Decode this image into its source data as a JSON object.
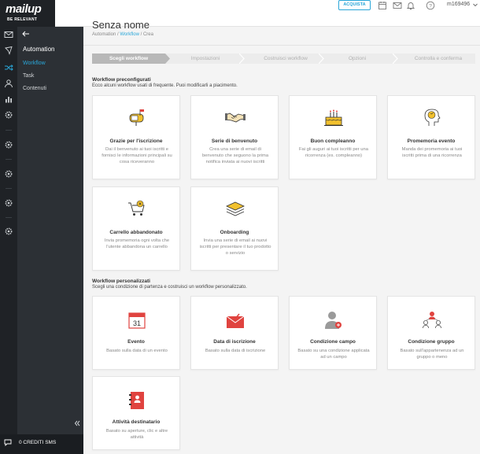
{
  "brand": {
    "name": "mailup",
    "tagline": "BE RELEVANT",
    "accent": "#2aa6d8"
  },
  "topbar": {
    "buy_label": "ACQUISTA",
    "username": "m169496"
  },
  "sidebar": {
    "title": "Automation",
    "items": [
      {
        "label": "Workflow",
        "active": true
      },
      {
        "label": "Task",
        "active": false
      },
      {
        "label": "Contenuti",
        "active": false
      }
    ],
    "credits": "0 CREDITI SMS"
  },
  "page": {
    "title": "Senza nome",
    "breadcrumb": [
      "Automation",
      "Workflow",
      "Crea"
    ]
  },
  "steps": [
    "Scegli workflow",
    "Impostazioni",
    "Costruisci workflow",
    "Opzioni",
    "Controlla e conferma"
  ],
  "preconfigured": {
    "title": "Workflow preconfigurati",
    "subtitle": "Ecco alcuni workflow usati di frequente. Puoi modificarli a piacimento.",
    "cards": [
      {
        "icon": "mailbox-icon",
        "title": "Grazie per l'iscrizione",
        "desc": "Dai il benvenuto ai tuoi iscritti e fornisci le informazioni principali su cosa riceveranno"
      },
      {
        "icon": "handshake-icon",
        "title": "Serie di benvenuto",
        "desc": "Crea una serie di email di benvenuto che seguono la prima notifica inviata ai nuovi iscritti"
      },
      {
        "icon": "cake-icon",
        "title": "Buon compleanno",
        "desc": "Fai gli auguri ai tuoi iscritti per una ricorrenza (es. compleanno)"
      },
      {
        "icon": "reminder-head-icon",
        "title": "Promemoria evento",
        "desc": "Manda dei promemoria ai tuoi iscritti prima di una ricorrenza"
      },
      {
        "icon": "cart-icon",
        "title": "Carrello abbandonato",
        "desc": "Invia promemoria ogni volta che l'utente abbandona un carrello"
      },
      {
        "icon": "layers-icon",
        "title": "Onboarding",
        "desc": "Invia una serie di email ai nuovi iscritti per presentare il tuo prodotto o servizio"
      }
    ]
  },
  "custom": {
    "title": "Workflow personalizzati",
    "subtitle": "Scegli una condizione di partenza e costruisci un workflow personalizzato.",
    "cards": [
      {
        "icon": "calendar-icon",
        "title": "Evento",
        "desc": "Basato sulla data di un evento",
        "day": "31"
      },
      {
        "icon": "envelope-icon",
        "title": "Data di iscrizione",
        "desc": "Basato sulla data di iscrizione"
      },
      {
        "icon": "user-condition-icon",
        "title": "Condizione campo",
        "desc": "Basato su una condizione applicata ad un campo"
      },
      {
        "icon": "group-condition-icon",
        "title": "Condizione gruppo",
        "desc": "Basato sull'appartenenza ad un gruppo o meno"
      },
      {
        "icon": "activity-book-icon",
        "title": "Attività destinatario",
        "desc": "Basato su aperture, clic e altre attività"
      }
    ]
  },
  "colors": {
    "accent": "#2aa6d8",
    "yellow": "#f2c12e",
    "red": "#e0433f",
    "dark": "#1f2226"
  }
}
